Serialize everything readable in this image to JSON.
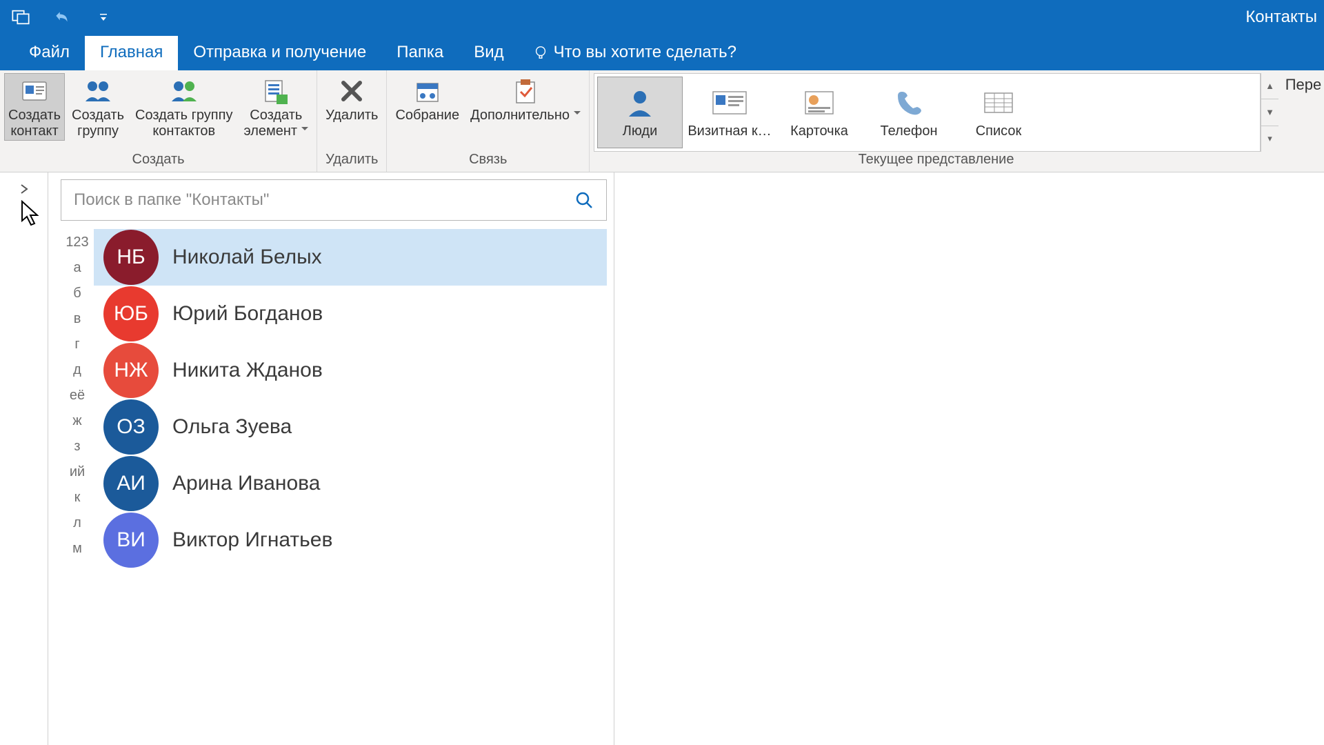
{
  "titlebar": {
    "app_title": "Контакты"
  },
  "tabs": {
    "file": "Файл",
    "home": "Главная",
    "send_receive": "Отправка и получение",
    "folder": "Папка",
    "view": "Вид",
    "tell_me": "Что вы хотите сделать?"
  },
  "ribbon": {
    "create": {
      "label": "Создать",
      "new_contact": "Создать\nконтакт",
      "new_group": "Создать\nгруппу",
      "new_contact_group": "Создать группу\nконтактов",
      "new_item": "Создать\nэлемент"
    },
    "delete": {
      "label": "Удалить",
      "delete_btn": "Удалить"
    },
    "communicate": {
      "label": "Связь",
      "meeting": "Собрание",
      "more": "Дополнительно"
    },
    "current_view": {
      "label": "Текущее представление",
      "people": "Люди",
      "business_card": "Визитная к…",
      "card": "Карточка",
      "phone": "Телефон",
      "list": "Список"
    },
    "overflow": "Пере"
  },
  "search": {
    "placeholder": "Поиск в папке \"Контакты\""
  },
  "az_index": [
    "123",
    "а",
    "б",
    "в",
    "г",
    "д",
    "её",
    "ж",
    "з",
    "ий",
    "к",
    "л",
    "м"
  ],
  "contacts": [
    {
      "initials": "НБ",
      "name": "Николай Белых",
      "color": "#8a1c2c",
      "selected": true
    },
    {
      "initials": "ЮБ",
      "name": "Юрий Богданов",
      "color": "#e83a2f",
      "selected": false
    },
    {
      "initials": "НЖ",
      "name": "Никита Жданов",
      "color": "#e74b3c",
      "selected": false
    },
    {
      "initials": "ОЗ",
      "name": "Ольга Зуева",
      "color": "#1b5a9a",
      "selected": false
    },
    {
      "initials": "АИ",
      "name": "Арина Иванова",
      "color": "#1b5a9a",
      "selected": false
    },
    {
      "initials": "ВИ",
      "name": "Виктор Игнатьев",
      "color": "#5b6fe0",
      "selected": false
    }
  ]
}
